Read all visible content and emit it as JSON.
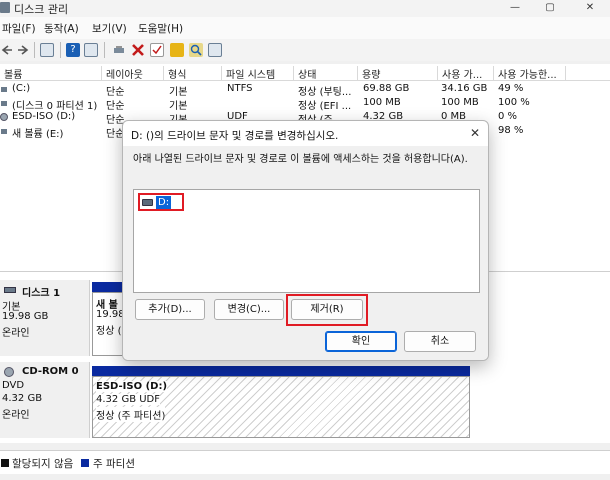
{
  "window": {
    "title": "디스크 관리",
    "minimize": "—",
    "maximize": "▢",
    "close": "✕"
  },
  "menu": [
    "파일(F)",
    "동작(A)",
    "보기(V)",
    "도움말(H)"
  ],
  "toolbar": {
    "icons": [
      "back-arrow-icon",
      "forward-arrow-icon",
      "properties-icon",
      "help-icon",
      "show-hide-icon",
      "connect-icon",
      "delete-icon",
      "check-icon",
      "open-icon",
      "search-icon",
      "details-icon"
    ],
    "colors": {
      "delete": "#c21a1a",
      "folder": "#e7b416",
      "help": "#1a5fb4"
    }
  },
  "volume_table": {
    "columns": [
      "볼륨",
      "레이아웃",
      "형식",
      "파일 시스템",
      "상태",
      "용량",
      "사용 가...",
      "사용 가능한..."
    ],
    "rows": [
      {
        "name": "(C:)",
        "layout": "단순",
        "type": "기본",
        "fs": "NTFS",
        "status": "정상 (부팅...",
        "capacity": "69.88 GB",
        "free": "34.16 GB",
        "pct": "49 %"
      },
      {
        "name": "(디스크 0 파티션 1)",
        "layout": "단순",
        "type": "기본",
        "fs": "",
        "status": "정상 (EFI ...",
        "capacity": "100 MB",
        "free": "100 MB",
        "pct": "100 %"
      },
      {
        "name": "ESD-ISO (D:)",
        "layout": "단순",
        "type": "기본",
        "fs": "UDF",
        "status": "정상 (주 ...",
        "capacity": "4.32 GB",
        "free": "0 MB",
        "pct": "0 %"
      },
      {
        "name": "새 볼륨 (E:)",
        "layout": "단순",
        "type": "",
        "fs": "",
        "status": "",
        "capacity": "",
        "free": "",
        "pct": "98 %"
      }
    ]
  },
  "disks": [
    {
      "name": "디스크 1",
      "kind": "기본",
      "size": "19.98 GB",
      "state": "온라인",
      "partition": {
        "title": "새 볼",
        "line1": "19.98",
        "line2": "정상 ("
      }
    },
    {
      "name": "CD-ROM 0",
      "kind": "DVD",
      "size": "4.32 GB",
      "state": "온라인",
      "partition": {
        "title": "ESD-ISO  (D:)",
        "line1": "4.32 GB UDF",
        "line2": "정상 (주 파티션)"
      }
    }
  ],
  "legend": [
    {
      "label": "할당되지 않음",
      "color": "#111111"
    },
    {
      "label": "주 파티션",
      "color": "#0a2aa0"
    }
  ],
  "dialog": {
    "title": "D: ()의 드라이브 문자 및 경로를 변경하십시오.",
    "description": "아래 나열된 드라이브 문자 및 경로로 이 볼륨에 액세스하는 것을 허용합니다(A).",
    "paths": [
      "D:"
    ],
    "buttons": {
      "add": "추가(D)...",
      "change": "변경(C)...",
      "remove": "제거(R)",
      "ok": "확인",
      "cancel": "취소"
    },
    "close": "✕"
  },
  "accent_colors": {
    "selection": "#0a64d8",
    "highlight_box": "#e01b24",
    "partition_bar": "#0a2aa0"
  }
}
